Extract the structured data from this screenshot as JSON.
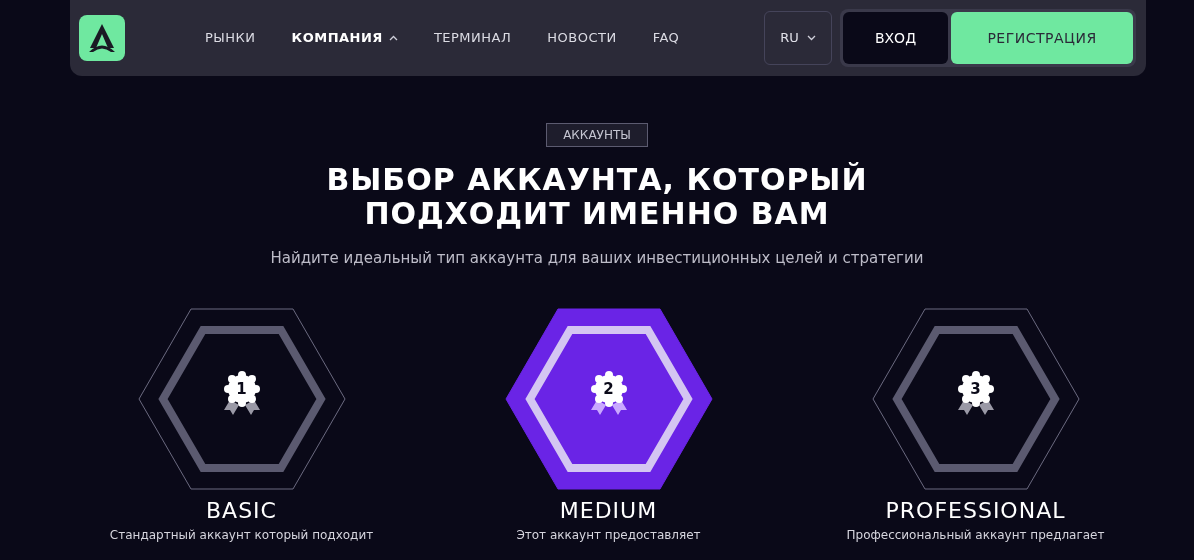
{
  "nav": {
    "links": [
      {
        "label": "РЫНКИ",
        "selected": false,
        "dropdown": false
      },
      {
        "label": "КОМПАНИЯ",
        "selected": true,
        "dropdown": true
      },
      {
        "label": "ТЕРМИНАЛ",
        "selected": false,
        "dropdown": false
      },
      {
        "label": "НОВОСТИ",
        "selected": false,
        "dropdown": false
      },
      {
        "label": "FAQ",
        "selected": false,
        "dropdown": false
      }
    ],
    "language": "RU",
    "login": "ВХОД",
    "register": "РЕГИСТРАЦИЯ"
  },
  "section": {
    "tag": "АККАУНТЫ",
    "title": "ВЫБОР АККАУНТА, КОТОРЫЙ ПОДХОДИТ ИМЕННО ВАМ",
    "subtitle": "Найдите идеальный тип аккаунта для ваших инвестиционных целей и стратегии"
  },
  "plans": [
    {
      "number": "1",
      "name": "BASIC",
      "description": "Стандартный аккаунт который подходит",
      "selected": false
    },
    {
      "number": "2",
      "name": "MEDIUM",
      "description": "Этот аккаунт предоставляет",
      "selected": true
    },
    {
      "number": "3",
      "name": "PROFESSIONAL",
      "description": "Профессиональный аккаунт предлагает",
      "selected": false
    }
  ]
}
